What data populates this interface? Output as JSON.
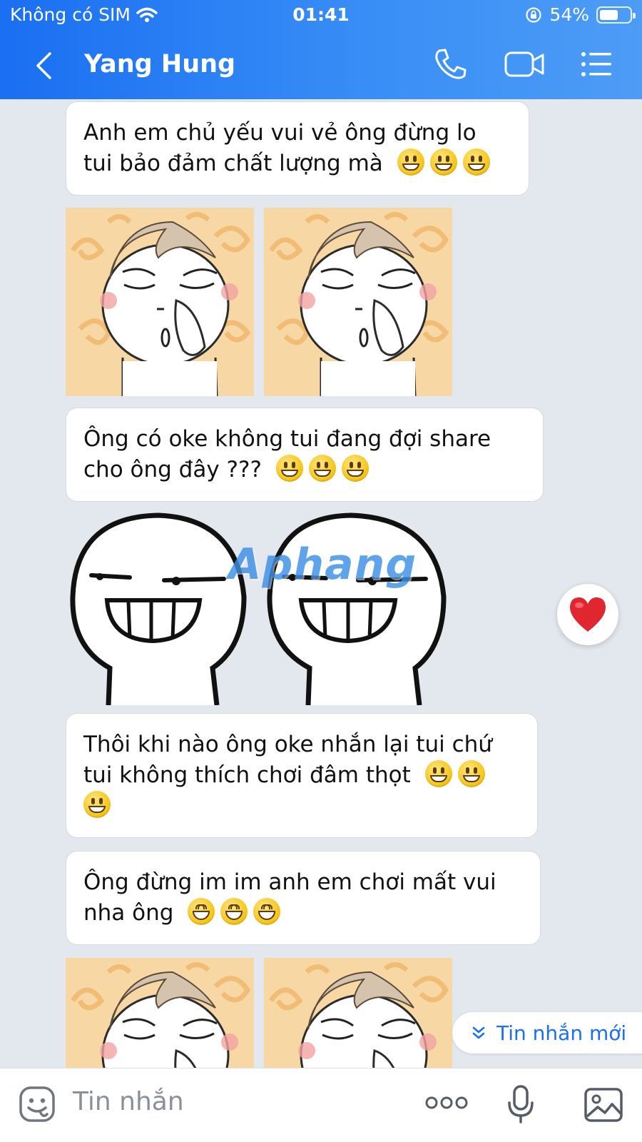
{
  "status_bar": {
    "carrier": "Không có SIM",
    "time": "01:41",
    "battery": "54%"
  },
  "header": {
    "title": "Yang Hung",
    "accent": "#1a6ff2"
  },
  "messages": [
    {
      "lines": [
        "Anh em chủ yếu vui vẻ ông đừng lo",
        "tui bảo đảm chất lượng mà"
      ]
    },
    {
      "lines": [
        "Ông có oke không tui đang đợi share",
        "cho ông đây ???"
      ]
    },
    {
      "lines": [
        "Thôi khi nào ông oke nhắn lại tui chứ",
        "tui không thích chơi đâm thọt"
      ]
    },
    {
      "lines": [
        "Ông đừng im im anh em chơi mất vui",
        "nha ông"
      ]
    }
  ],
  "watermark": "Aphang",
  "reaction": {
    "icon": "heart-icon",
    "color": "#e0262f"
  },
  "new_message_banner": {
    "label": "Tin nhắn mới"
  },
  "composer": {
    "placeholder": "Tin nhắn"
  }
}
